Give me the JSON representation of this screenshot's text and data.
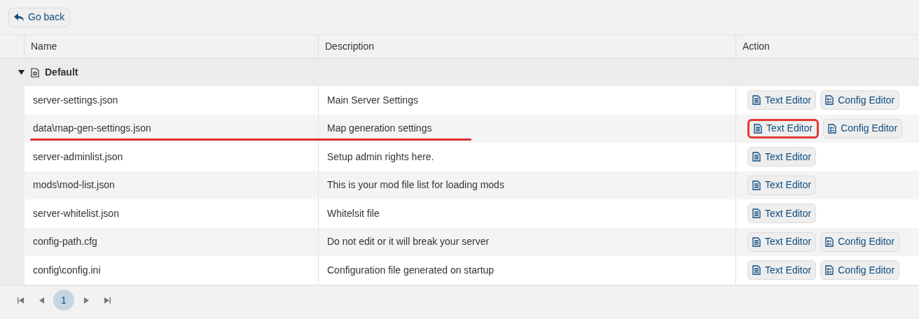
{
  "back_button": {
    "label": "Go back"
  },
  "table": {
    "columns": [
      "Name",
      "Description",
      "Action"
    ],
    "group": {
      "label": "Default",
      "expanded": true
    },
    "rows": [
      {
        "name": "server-settings.json",
        "description": "Main Server Settings",
        "underlined": false,
        "actions": [
          {
            "kind": "text",
            "label": "Text Editor",
            "highlighted": false
          },
          {
            "kind": "config",
            "label": "Config Editor",
            "highlighted": false
          }
        ]
      },
      {
        "name": "data\\map-gen-settings.json",
        "description": "Map generation settings",
        "underlined": true,
        "actions": [
          {
            "kind": "text",
            "label": "Text Editor",
            "highlighted": true
          },
          {
            "kind": "config",
            "label": "Config Editor",
            "highlighted": false
          }
        ]
      },
      {
        "name": "server-adminlist.json",
        "description": "Setup admin rights here.",
        "underlined": false,
        "actions": [
          {
            "kind": "text",
            "label": "Text Editor",
            "highlighted": false
          }
        ]
      },
      {
        "name": "mods\\mod-list.json",
        "description": "This is your mod file list for loading mods",
        "underlined": false,
        "actions": [
          {
            "kind": "text",
            "label": "Text Editor",
            "highlighted": false
          }
        ]
      },
      {
        "name": "server-whitelist.json",
        "description": "Whitelsit file",
        "underlined": false,
        "actions": [
          {
            "kind": "text",
            "label": "Text Editor",
            "highlighted": false
          }
        ]
      },
      {
        "name": "config-path.cfg",
        "description": "Do not edit or it will break your server",
        "underlined": false,
        "actions": [
          {
            "kind": "text",
            "label": "Text Editor",
            "highlighted": false
          },
          {
            "kind": "config",
            "label": "Config Editor",
            "highlighted": false
          }
        ]
      },
      {
        "name": "config\\config.ini",
        "description": "Configuration file generated on startup",
        "underlined": false,
        "actions": [
          {
            "kind": "text",
            "label": "Text Editor",
            "highlighted": false
          },
          {
            "kind": "config",
            "label": "Config Editor",
            "highlighted": false
          }
        ]
      }
    ]
  },
  "pagination": {
    "pages": [
      {
        "label": "1",
        "selected": true
      }
    ]
  }
}
